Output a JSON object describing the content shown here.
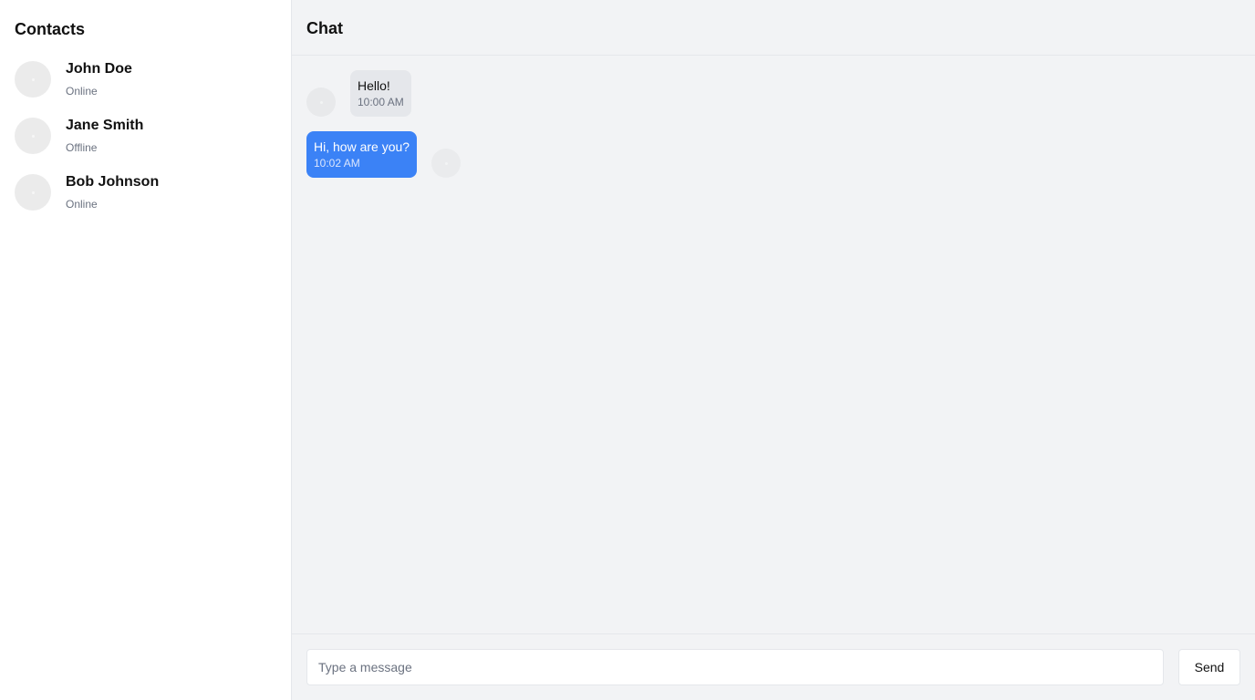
{
  "sidebar": {
    "title": "Contacts",
    "contacts": [
      {
        "name": "John Doe",
        "status": "Online"
      },
      {
        "name": "Jane Smith",
        "status": "Offline"
      },
      {
        "name": "Bob Johnson",
        "status": "Online"
      }
    ]
  },
  "chat": {
    "title": "Chat",
    "messages": [
      {
        "direction": "incoming",
        "text": "Hello!",
        "time": "10:00 AM"
      },
      {
        "direction": "outgoing",
        "text": "Hi, how are you?",
        "time": "10:02 AM"
      }
    ]
  },
  "composer": {
    "placeholder": "Type a message",
    "value": "",
    "send_label": "Send"
  },
  "colors": {
    "accent": "#3b82f6",
    "main_background": "#f2f3f5",
    "incoming_bubble": "#e5e7eb",
    "muted_text": "#6b7280"
  }
}
